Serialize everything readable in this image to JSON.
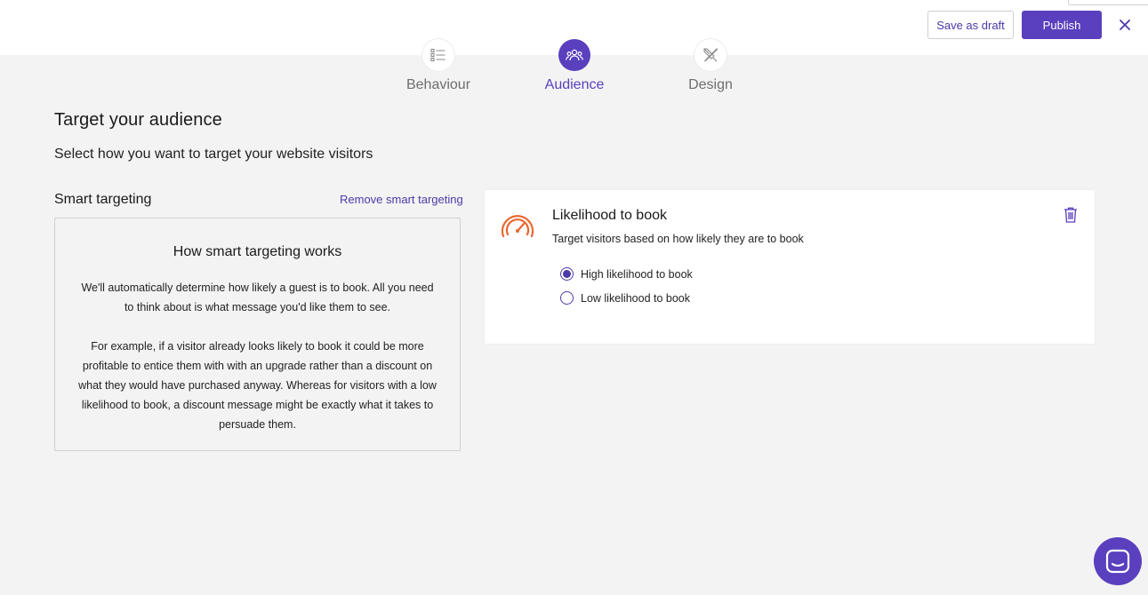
{
  "header": {
    "save_draft_label": "Save as draft",
    "publish_label": "Publish"
  },
  "steps": [
    {
      "label": "Behaviour",
      "icon": "list-icon",
      "active": false
    },
    {
      "label": "Audience",
      "icon": "people-icon",
      "active": true
    },
    {
      "label": "Design",
      "icon": "design-tools-icon",
      "active": false
    }
  ],
  "main": {
    "title": "Target your audience",
    "subtitle": "Select how you want to target your website visitors"
  },
  "smart_targeting": {
    "title": "Smart targeting",
    "remove_label": "Remove smart targeting",
    "info": {
      "heading": "How smart targeting works",
      "paragraph1": "We'll automatically determine how likely a guest is to book. All you need to think about is what message you'd like them to see.",
      "paragraph2": "For example, if a visitor already looks likely to book it could be more profitable to entice them with with an upgrade rather than a discount on what they would have purchased anyway. Whereas for visitors with a low likelihood to book, a discount message might be exactly what it takes to persuade them."
    }
  },
  "card": {
    "title": "Likelihood to book",
    "subtitle": "Target visitors based on how likely they are to book",
    "options": [
      {
        "label": "High likelihood to book",
        "selected": true
      },
      {
        "label": "Low likelihood to book",
        "selected": false
      }
    ]
  },
  "colors": {
    "accent": "#5a3fbe",
    "gauge": "#e8672e",
    "background": "#f3f3f3"
  }
}
